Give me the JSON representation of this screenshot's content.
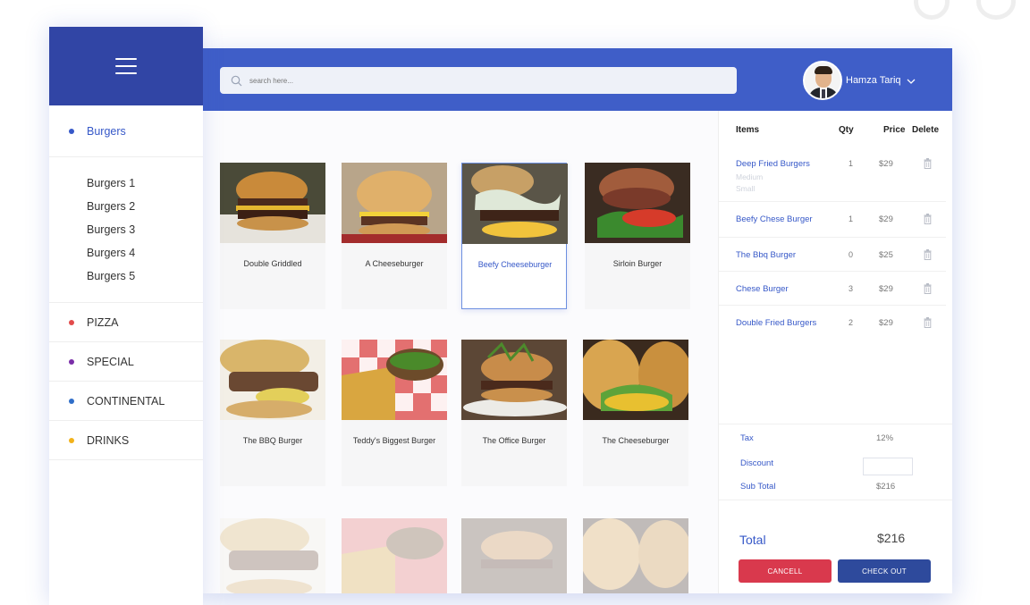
{
  "sidebar": {
    "categories": [
      {
        "label": "Burgers",
        "dot": "#3658c8",
        "active": true
      },
      {
        "label": "PIZZA",
        "dot": "#e24b4b"
      },
      {
        "label": "SPECIAL",
        "dot": "#7a2ea8"
      },
      {
        "label": "CONTINENTAL",
        "dot": "#2f6ec8"
      },
      {
        "label": "DRINKS",
        "dot": "#f2b21a"
      }
    ],
    "subitems": [
      "Burgers 1",
      "Burgers 2",
      "Burgers 3",
      "Burgers 4",
      "Burgers 5"
    ]
  },
  "search": {
    "placeholder": "search here..."
  },
  "user": {
    "name": "Hamza Tariq"
  },
  "products": [
    {
      "name": "Double Griddled"
    },
    {
      "name": "A Cheeseburger"
    },
    {
      "name": "Beefy Cheeseburger",
      "selected": true
    },
    {
      "name": "Sirloin Burger"
    },
    {
      "name": "The BBQ Burger"
    },
    {
      "name": "Teddy's Biggest Burger"
    },
    {
      "name": "The Office Burger"
    },
    {
      "name": "The Cheeseburger"
    }
  ],
  "order": {
    "headers": {
      "items": "Items",
      "qty": "Qty",
      "price": "Price",
      "delete": "Delete"
    },
    "rows": [
      {
        "name": "Deep Fried Burgers",
        "options": [
          "Medium",
          "Small"
        ],
        "qty": "1",
        "price": "$29"
      },
      {
        "name": "Beefy Chese Burger",
        "qty": "1",
        "price": "$29"
      },
      {
        "name": "The Bbq Burger",
        "qty": "0",
        "price": "$25"
      },
      {
        "name": "Chese Burger",
        "qty": "3",
        "price": "$29"
      },
      {
        "name": "Double Fried Burgers",
        "qty": "2",
        "price": "$29"
      }
    ],
    "tax_label": "Tax",
    "tax_value": "12%",
    "discount_label": "Discount",
    "discount_value": "",
    "subtotal_label": "Sub Total",
    "subtotal_value": "$216",
    "total_label": "Total",
    "total_value": "$216",
    "cancel_label": "CANCELL",
    "checkout_label": "CHECK OUT"
  },
  "colors": {
    "brand_blue": "#3f5ec8",
    "sidebar_header": "#3145a5",
    "accent_text": "#3658c8",
    "cancel": "#d9394d",
    "checkout": "#2e4a9c"
  }
}
